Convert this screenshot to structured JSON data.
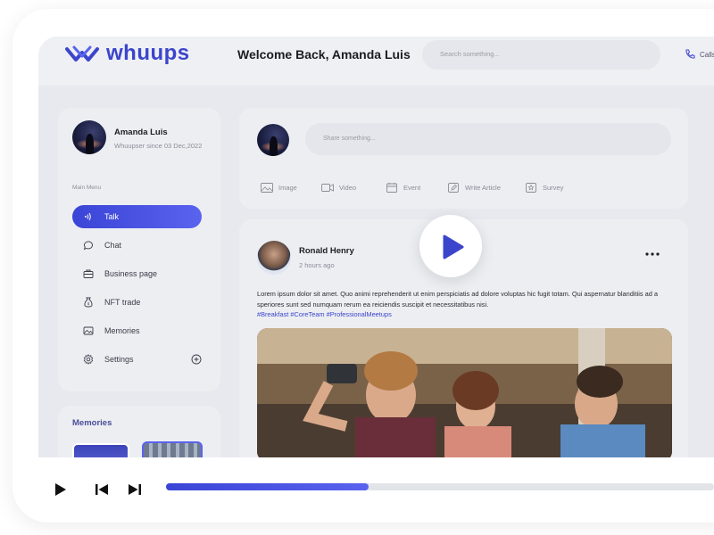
{
  "app": {
    "logo_text": "whuups",
    "welcome": "Welcome Back, Amanda Luis",
    "search_placeholder": "Search something...",
    "call_label": "Calls"
  },
  "profile": {
    "name": "Amanda Luis",
    "since": "Whuupser since 03 Dec,2022"
  },
  "sidebar": {
    "menu_title": "Main Menu",
    "items": [
      {
        "label": "Talk",
        "icon": "talk-icon",
        "active": true
      },
      {
        "label": "Chat",
        "icon": "chat-icon",
        "active": false
      },
      {
        "label": "Business page",
        "icon": "briefcase-icon",
        "active": false
      },
      {
        "label": "NFT trade",
        "icon": "nft-icon",
        "active": false
      },
      {
        "label": "Memories",
        "icon": "memories-icon",
        "active": false
      },
      {
        "label": "Settings",
        "icon": "gear-icon",
        "active": false
      }
    ],
    "memories_title": "Memories"
  },
  "composer": {
    "placeholder": "Share something...",
    "tools": [
      "Image",
      "Video",
      "Event",
      "Write Article",
      "Survey"
    ]
  },
  "post": {
    "author": "Ronald Henry",
    "time": "2 hours ago",
    "text": "Lorem ipsum dolor sit amet. Quo animi reprehenderit ut enim perspiciatis ad dolore voluptas hic fugit totam. Qui aspernatur blanditiis ad a speriores sunt sed numquam rerum ea reiciendis suscipit et necessitatibus nisi.",
    "tags": "#Breakfast #CoreTeam #ProfessionalMeetups"
  },
  "player": {
    "progress": 0.37
  },
  "colors": {
    "accent": "#3b45cc",
    "accent_light": "#5a63ee"
  }
}
